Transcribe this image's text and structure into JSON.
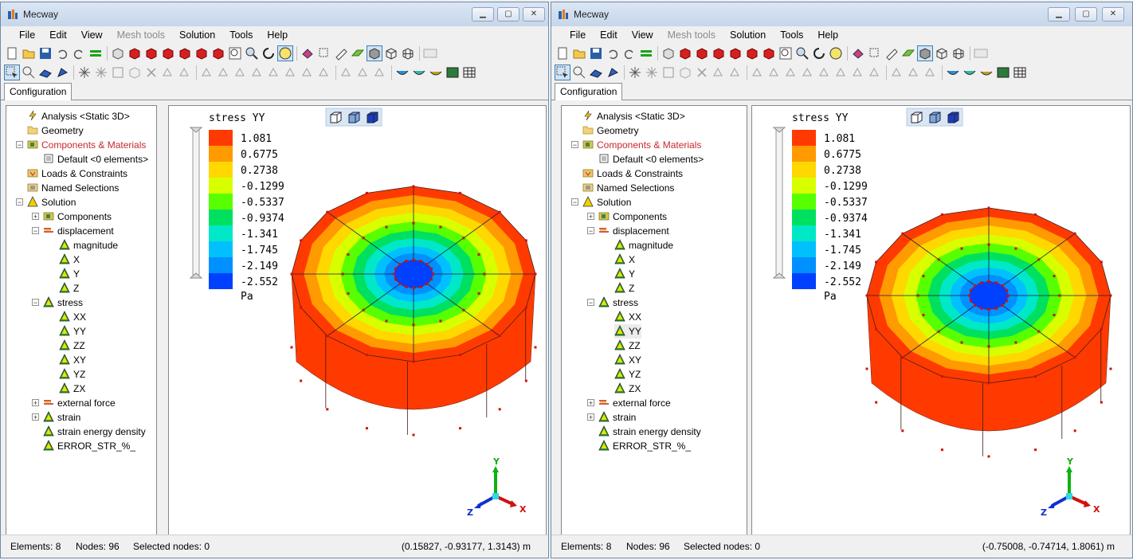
{
  "windows": [
    {
      "title": "Mecway",
      "menu": [
        "File",
        "Edit",
        "View",
        "Mesh tools",
        "Solution",
        "Tools",
        "Help"
      ],
      "tab": "Configuration",
      "tree": [
        {
          "label": "Analysis <Static 3D>",
          "icon": "lightning-icon",
          "level": 0
        },
        {
          "label": "Geometry",
          "icon": "folder-icon",
          "level": 0
        },
        {
          "label": "Components & Materials",
          "icon": "components-icon",
          "level": 0,
          "expanded": true,
          "red": true
        },
        {
          "label": "Default <0 elements>",
          "icon": "component-default-icon",
          "level": 1
        },
        {
          "label": "Loads & Constraints",
          "icon": "loads-icon",
          "level": 0
        },
        {
          "label": "Named Selections",
          "icon": "selections-icon",
          "level": 0
        },
        {
          "label": "Solution",
          "icon": "solution-triangle-icon",
          "level": 0,
          "expanded": true
        },
        {
          "label": "Components",
          "icon": "components-icon",
          "level": 1,
          "collapsed": true
        },
        {
          "label": "displacement",
          "icon": "displacement-icon",
          "level": 1,
          "expanded": true
        },
        {
          "label": "magnitude",
          "icon": "result-triangle-icon",
          "level": 2
        },
        {
          "label": "X",
          "icon": "result-triangle-icon",
          "level": 2
        },
        {
          "label": "Y",
          "icon": "result-triangle-icon",
          "level": 2
        },
        {
          "label": "Z",
          "icon": "result-triangle-icon",
          "level": 2
        },
        {
          "label": "stress",
          "icon": "result-triangle-icon",
          "level": 1,
          "expanded": true
        },
        {
          "label": "XX",
          "icon": "result-triangle-icon",
          "level": 2
        },
        {
          "label": "YY",
          "icon": "result-triangle-icon",
          "level": 2
        },
        {
          "label": "ZZ",
          "icon": "result-triangle-icon",
          "level": 2
        },
        {
          "label": "XY",
          "icon": "result-triangle-icon",
          "level": 2
        },
        {
          "label": "YZ",
          "icon": "result-triangle-icon",
          "level": 2
        },
        {
          "label": "ZX",
          "icon": "result-triangle-icon",
          "level": 2
        },
        {
          "label": "external force",
          "icon": "force-icon",
          "level": 1,
          "collapsed": true
        },
        {
          "label": "strain",
          "icon": "result-triangle-icon",
          "level": 1,
          "collapsed": true
        },
        {
          "label": "strain energy density",
          "icon": "result-triangle-icon",
          "level": 1
        },
        {
          "label": "ERROR_STR_%_",
          "icon": "result-triangle-icon",
          "level": 1
        }
      ],
      "legend": {
        "title": "stress YY",
        "values": [
          "1.081",
          "0.6775",
          "0.2738",
          "-0.1299",
          "-0.5337",
          "-0.9374",
          "-1.341",
          "-1.745",
          "-2.149",
          "-2.552"
        ],
        "unit": "Pa"
      },
      "status": {
        "elements": "Elements: 8",
        "nodes": "Nodes: 96",
        "selected": "Selected nodes: 0",
        "coords": "(0.15827, -0.93177, 1.3143) m"
      },
      "axes": {
        "x": "X",
        "y": "Y",
        "z": "Z"
      }
    },
    {
      "title": "Mecway",
      "menu": [
        "File",
        "Edit",
        "View",
        "Mesh tools",
        "Solution",
        "Tools",
        "Help"
      ],
      "tab": "Configuration",
      "tree": [
        {
          "label": "Analysis <Static 3D>",
          "icon": "lightning-icon",
          "level": 0
        },
        {
          "label": "Geometry",
          "icon": "folder-icon",
          "level": 0
        },
        {
          "label": "Components & Materials",
          "icon": "components-icon",
          "level": 0,
          "expanded": true,
          "red": true
        },
        {
          "label": "Default <0 elements>",
          "icon": "component-default-icon",
          "level": 1
        },
        {
          "label": "Loads & Constraints",
          "icon": "loads-icon",
          "level": 0
        },
        {
          "label": "Named Selections",
          "icon": "selections-icon",
          "level": 0
        },
        {
          "label": "Solution",
          "icon": "solution-triangle-icon",
          "level": 0,
          "expanded": true
        },
        {
          "label": "Components",
          "icon": "components-icon",
          "level": 1,
          "collapsed": true
        },
        {
          "label": "displacement",
          "icon": "displacement-icon",
          "level": 1,
          "expanded": true
        },
        {
          "label": "magnitude",
          "icon": "result-triangle-icon",
          "level": 2
        },
        {
          "label": "X",
          "icon": "result-triangle-icon",
          "level": 2
        },
        {
          "label": "Y",
          "icon": "result-triangle-icon",
          "level": 2
        },
        {
          "label": "Z",
          "icon": "result-triangle-icon",
          "level": 2
        },
        {
          "label": "stress",
          "icon": "result-triangle-icon",
          "level": 1,
          "expanded": true
        },
        {
          "label": "XX",
          "icon": "result-triangle-icon",
          "level": 2
        },
        {
          "label": "YY",
          "icon": "result-triangle-icon",
          "level": 2,
          "selected": true
        },
        {
          "label": "ZZ",
          "icon": "result-triangle-icon",
          "level": 2
        },
        {
          "label": "XY",
          "icon": "result-triangle-icon",
          "level": 2
        },
        {
          "label": "YZ",
          "icon": "result-triangle-icon",
          "level": 2
        },
        {
          "label": "ZX",
          "icon": "result-triangle-icon",
          "level": 2
        },
        {
          "label": "external force",
          "icon": "force-icon",
          "level": 1,
          "collapsed": true
        },
        {
          "label": "strain",
          "icon": "result-triangle-icon",
          "level": 1,
          "collapsed": true
        },
        {
          "label": "strain energy density",
          "icon": "result-triangle-icon",
          "level": 1
        },
        {
          "label": "ERROR_STR_%_",
          "icon": "result-triangle-icon",
          "level": 1
        }
      ],
      "legend": {
        "title": "stress YY",
        "values": [
          "1.081",
          "0.6775",
          "0.2738",
          "-0.1299",
          "-0.5337",
          "-0.9374",
          "-1.341",
          "-1.745",
          "-2.149",
          "-2.552"
        ],
        "unit": "Pa"
      },
      "status": {
        "elements": "Elements: 8",
        "nodes": "Nodes: 96",
        "selected": "Selected nodes: 0",
        "coords": "(-0.75008, -0.74714, 1.8061) m"
      },
      "axes": {
        "x": "X",
        "y": "Y",
        "z": "Z"
      }
    }
  ],
  "colors": {
    "legend_bands": [
      "#ff3a00",
      "#ff9a00",
      "#ffd800",
      "#d8ff00",
      "#58ff00",
      "#00e060",
      "#00e8c8",
      "#00c0ff",
      "#0090ff",
      "#0040ff"
    ],
    "cylinder_side": "#ff3a00",
    "node_marker": "#d01010"
  }
}
